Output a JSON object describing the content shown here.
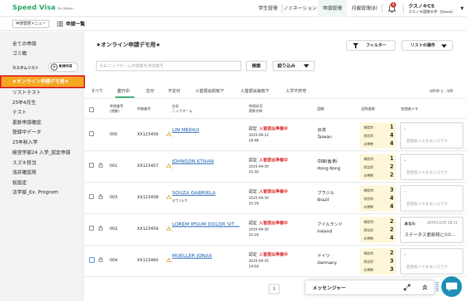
{
  "app": {
    "logo": "Speed Visa",
    "logo_sub": "for Admin"
  },
  "nav": {
    "tabs": [
      "学生管理",
      "ノミネーション",
      "申請管理",
      "月報管理(β)"
    ],
    "active_tab": "申請管理",
    "notification_count": "1",
    "user_name": "クスノキCS",
    "user_org": "クスノキ国際大学（Demo）"
  },
  "subheader": {
    "menu_button": "申請管理メニュー",
    "title": "申請一覧"
  },
  "sidebar": {
    "top_items": [
      "全ての申請",
      "ゴミ箱"
    ],
    "custom_list_label": "カスタムリスト",
    "new_button": "新規作成",
    "active_item": "★オンライン申請デモ用★",
    "items": [
      "リストテスト",
      "25年4月生",
      "テスト",
      "更新申請確認",
      "登録中データ",
      "25年秋入学",
      "経営学部24 入学_認定申請",
      "スズキ担当",
      "浅井確認用",
      "仮設定",
      "法学部_Ex. Program"
    ]
  },
  "main": {
    "title": "★オンライン申請デモ用★",
    "filter_button": "フィルター",
    "list_ops_button": "リストの操作",
    "search_placeholder": "氏名/ニックネーム/学籍番号/申請番号",
    "search_button": "検索",
    "narrow_button": "絞り込み",
    "tabs": [
      "すべて",
      "進行中",
      "交付",
      "不交付",
      "入管提出前取下",
      "入管提出後取下",
      "入学不許可"
    ],
    "active_tab": "進行中",
    "count_text": "5件中 1 - 5件"
  },
  "table": {
    "headers": {
      "app_no": "申請番号",
      "app_no_sub": "(通番)",
      "student_no": "学籍番号",
      "name": "氏名",
      "name_sub": "ニックネーム",
      "status": "申請状況",
      "status_sub": "更新日時",
      "nationality": "国籍",
      "docs": "証明書類",
      "memo": "管理者メモ"
    },
    "doc_labels": [
      "確認済：",
      "提出前：",
      "必要数："
    ],
    "memo_placeholder": "管理者メモを未入力です",
    "rows": [
      {
        "app_no": "005",
        "student_no": "XX123456",
        "name": "LIN MEIHUI",
        "nick": "-",
        "status": "認定",
        "status_detail": "入管提出準備中",
        "date": "2025-06-12",
        "time": "16:48",
        "nat_ja": "台湾",
        "nat_en": "Taiwan",
        "docs": [
          "1",
          "4",
          "4"
        ],
        "memo_author": "",
        "memo_date": "",
        "memo_text": "",
        "locked": false,
        "focused": false
      },
      {
        "app_no": "001",
        "student_no": "XX123457",
        "name": "JOHNSON ETHAN",
        "nick": "-",
        "status": "認定",
        "status_detail": "入管提出準備中",
        "date": "2025-04-30",
        "time": "15:30",
        "nat_ja": "中国(香港)",
        "nat_en": "Hong Kong",
        "docs": [
          "1",
          "2",
          "2"
        ],
        "memo_author": "",
        "memo_date": "",
        "memo_text": "",
        "locked": true,
        "focused": false
      },
      {
        "app_no": "003",
        "student_no": "XX123458",
        "name": "SOUZA GABRIELA",
        "nick": "ガブリエラ",
        "status": "認定",
        "status_detail": "入管提出準備中",
        "date": "2025-04-30",
        "time": "15:29",
        "nat_ja": "ブラジル",
        "nat_en": "Brazil",
        "docs": [
          "3",
          "4",
          "4"
        ],
        "memo_author": "",
        "memo_date": "",
        "memo_text": "",
        "locked": true,
        "focused": false
      },
      {
        "app_no": "002",
        "student_no": "XX123459",
        "name": "LOREM IPSUM DOLOR SIT…",
        "nick": "-",
        "status": "認定",
        "status_detail": "入管提出準備中",
        "date": "2025-04-30",
        "time": "15:29",
        "nat_ja": "アイルランド",
        "nat_en": "Ireland",
        "docs": [
          "2",
          "2",
          "4"
        ],
        "memo_author": "あなた",
        "memo_date": "2024/11/25 18:11",
        "memo_text": "ステータス更新時にCO…",
        "locked": true,
        "focused": false
      },
      {
        "app_no": "004",
        "student_no": "XX123460",
        "name": "MUELLER JONAS",
        "nick": "-",
        "status": "認定",
        "status_detail": "入管提出準備中",
        "date": "2025-04-25",
        "time": "14:59",
        "nat_ja": "ドイツ",
        "nat_en": "Germany",
        "docs": [
          "2",
          "3",
          "3"
        ],
        "memo_author": "",
        "memo_date": "",
        "memo_text": "",
        "locked": true,
        "focused": true
      }
    ]
  },
  "pager": {
    "page": "1"
  },
  "messenger": {
    "label": "メッセンジャー"
  },
  "colors": {
    "brand": "#2aa865",
    "link": "#1a5fb4",
    "status_red": "#d92b2b",
    "sidebar_active": "#f5a623",
    "chat": "#1f8fb8"
  }
}
